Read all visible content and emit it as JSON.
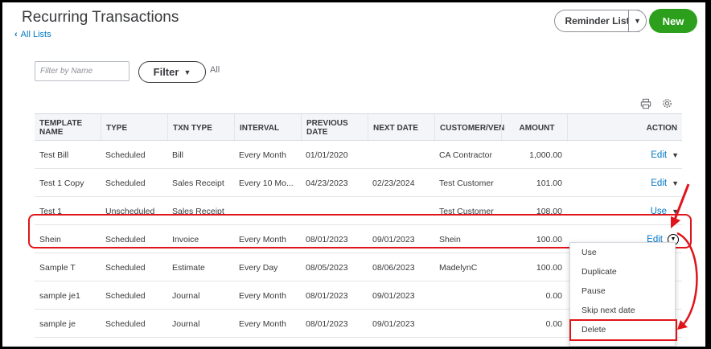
{
  "header": {
    "title": "Recurring Transactions",
    "back_link": "All Lists",
    "reminder_button": "Reminder List",
    "new_button": "New"
  },
  "filter": {
    "placeholder": "Filter by Name",
    "button_label": "Filter",
    "status": "All"
  },
  "table": {
    "columns": [
      "TEMPLATE NAME",
      "TYPE",
      "TXN TYPE",
      "INTERVAL",
      "PREVIOUS DATE",
      "NEXT DATE",
      "CUSTOMER/VEN",
      "AMOUNT",
      "ACTION"
    ],
    "rows": [
      {
        "name": "Test Bill",
        "type": "Scheduled",
        "txn": "Bill",
        "interval": "Every Month",
        "prev": "01/01/2020",
        "next": "",
        "customer": "CA Contractor",
        "amount": "1,000.00",
        "action": "Edit"
      },
      {
        "name": "Test 1 Copy",
        "type": "Scheduled",
        "txn": "Sales Receipt",
        "interval": "Every 10 Mo...",
        "prev": "04/23/2023",
        "next": "02/23/2024",
        "customer": "Test Customer",
        "amount": "101.00",
        "action": "Edit"
      },
      {
        "name": "Test 1",
        "type": "Unscheduled",
        "txn": "Sales Receipt",
        "interval": "",
        "prev": "",
        "next": "",
        "customer": "Test Customer",
        "amount": "108.00",
        "action": "Use"
      },
      {
        "name": "Shein",
        "type": "Scheduled",
        "txn": "Invoice",
        "interval": "Every Month",
        "prev": "08/01/2023",
        "next": "09/01/2023",
        "customer": "Shein",
        "amount": "100.00",
        "action": "Edit"
      },
      {
        "name": "Sample T",
        "type": "Scheduled",
        "txn": "Estimate",
        "interval": "Every Day",
        "prev": "08/05/2023",
        "next": "08/06/2023",
        "customer": "MadelynC",
        "amount": "100.00",
        "action": ""
      },
      {
        "name": "sample je1",
        "type": "Scheduled",
        "txn": "Journal",
        "interval": "Every Month",
        "prev": "08/01/2023",
        "next": "09/01/2023",
        "customer": "",
        "amount": "0.00",
        "action": ""
      },
      {
        "name": "sample je",
        "type": "Scheduled",
        "txn": "Journal",
        "interval": "Every Month",
        "prev": "08/01/2023",
        "next": "09/01/2023",
        "customer": "",
        "amount": "0.00",
        "action": ""
      }
    ]
  },
  "action_menu": {
    "items": [
      "Use",
      "Duplicate",
      "Pause",
      "Skip next date",
      "Delete"
    ]
  },
  "colors": {
    "link": "#0077c5",
    "primary_button": "#2ca01c",
    "annotation": "#e0141a"
  },
  "icons": [
    "chevron-left-icon",
    "caret-down-icon",
    "print-icon",
    "gear-icon"
  ]
}
